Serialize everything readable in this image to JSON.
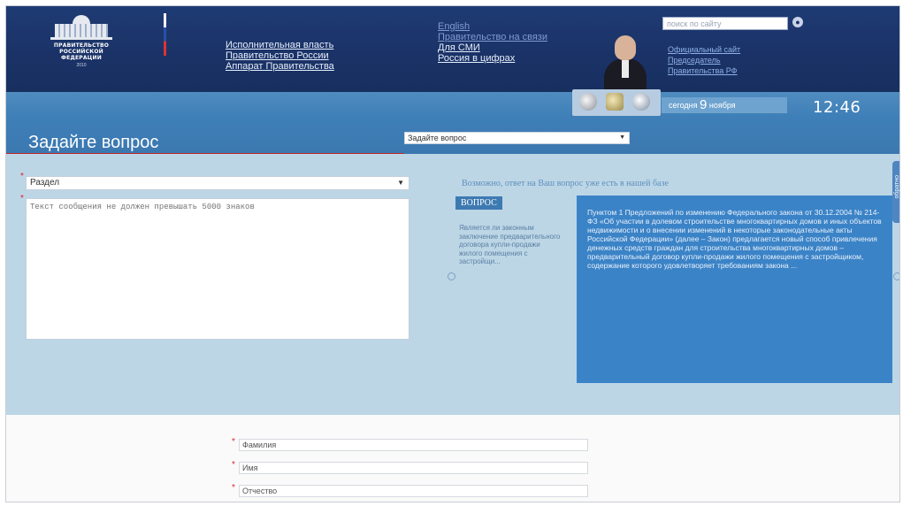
{
  "header": {
    "logo": {
      "lines": [
        "ПРАВИТЕЛЬСТВО",
        "РОССИЙСКОЙ",
        "ФЕДЕРАЦИИ"
      ],
      "year": "2010"
    },
    "links_primary": [
      "Исполнительная власть",
      "Правительство России",
      "Аппарат Правительства"
    ],
    "links_secondary": [
      "English",
      "Правительство на связи",
      "Для СМИ",
      "Россия в цифрах"
    ],
    "search": {
      "placeholder": "поиск по сайту"
    },
    "links_tertiary": [
      "Официальный сайт",
      "Председатель",
      "Правительства РФ"
    ],
    "date": {
      "prefix": "сегодня",
      "day": "9",
      "month": "ноября"
    },
    "time": "12:46"
  },
  "page": {
    "title": "Задайте вопрос",
    "topic_select": "Задайте вопрос"
  },
  "form": {
    "section_select": "Раздел",
    "message_placeholder": "Текст сообщения не должен превышать 5000 знаков",
    "fields": [
      {
        "placeholder": "Фамилия"
      },
      {
        "placeholder": "Имя"
      },
      {
        "placeholder": "Отчество"
      }
    ]
  },
  "suggestion": {
    "heading": "Возможно, ответ на Ваш вопрос уже есть в нашей базе",
    "badge": "ВОПРОС",
    "short": "Является ли законным заключение предварительного договора купли-продажи жилого помещения с застройщи...",
    "answer": "Пунктом 1 Предложений по изменению Федерального закона от 30.12.2004 № 214-ФЗ «Об участии в долевом строительстве многоквартирных домов и иных объектов недвижимости и о внесении изменений в некоторые законодательные акты Российской Федерации» (далее – Закон) предлагается новый способ привлечения денежных средств граждан для строительства многоквартирных домов – предварительный договор купли-продажи жилого помещения с застройщиком, содержание которого удовлетворяет требованиям закона ...",
    "side_tab": "обратно"
  },
  "colors": {
    "header_bg": "#1a3266",
    "band_bg": "#3f7fb8",
    "accent_red": "#c0282d",
    "answer_bg": "#3b83c7",
    "main_bg": "#bcd6e6"
  }
}
